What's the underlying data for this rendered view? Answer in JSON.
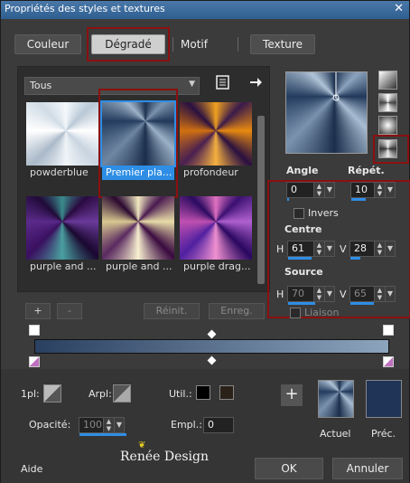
{
  "window": {
    "title": "Propriétés des styles et textures",
    "close": "✕"
  },
  "tabs": [
    {
      "label": "Couleur"
    },
    {
      "label": "Dégradé"
    },
    {
      "label": "Motif"
    },
    {
      "label": "Texture"
    }
  ],
  "filter": {
    "value": "Tous"
  },
  "gradients": [
    {
      "label": "powderblue"
    },
    {
      "label": "Premier pla..."
    },
    {
      "label": "profondeur"
    },
    {
      "label": "purple and ..."
    },
    {
      "label": "purple and ..."
    },
    {
      "label": "purple drag..."
    }
  ],
  "stop_buttons": {
    "add": "+",
    "remove": "-",
    "reset": "Réinit.",
    "save": "Enreg."
  },
  "settings": {
    "angle_label": "Angle",
    "angle_value": "0",
    "repeat_label": "Répét.",
    "repeat_value": "10",
    "invert_label": "Invers",
    "center_label": "Centre",
    "center_h_label": "H",
    "center_h": "61",
    "center_v_label": "V",
    "center_v": "28",
    "source_label": "Source",
    "source_h_label": "H",
    "source_h": "70",
    "source_v_label": "V",
    "source_v": "65",
    "link_label": "Liaison"
  },
  "bottom": {
    "pl_label": "1pl:",
    "arpl_label": "Arpl:",
    "util_label": "Util.:",
    "opacity_label": "Opacité:",
    "opacity_value": "100",
    "empl_label": "Empl.:",
    "empl_value": "0",
    "add_button": "+",
    "current_label": "Actuel",
    "previous_label": "Préc.",
    "help_label": "Aide",
    "ok_label": "OK",
    "cancel_label": "Annuler",
    "watermark": "Renée Design"
  },
  "colors": {
    "accent": "#2e8ee6",
    "highlight": "#8b1010",
    "prev_swatch": "#1f3456",
    "util_black": "#000000",
    "util_dark": "#2a2118"
  }
}
